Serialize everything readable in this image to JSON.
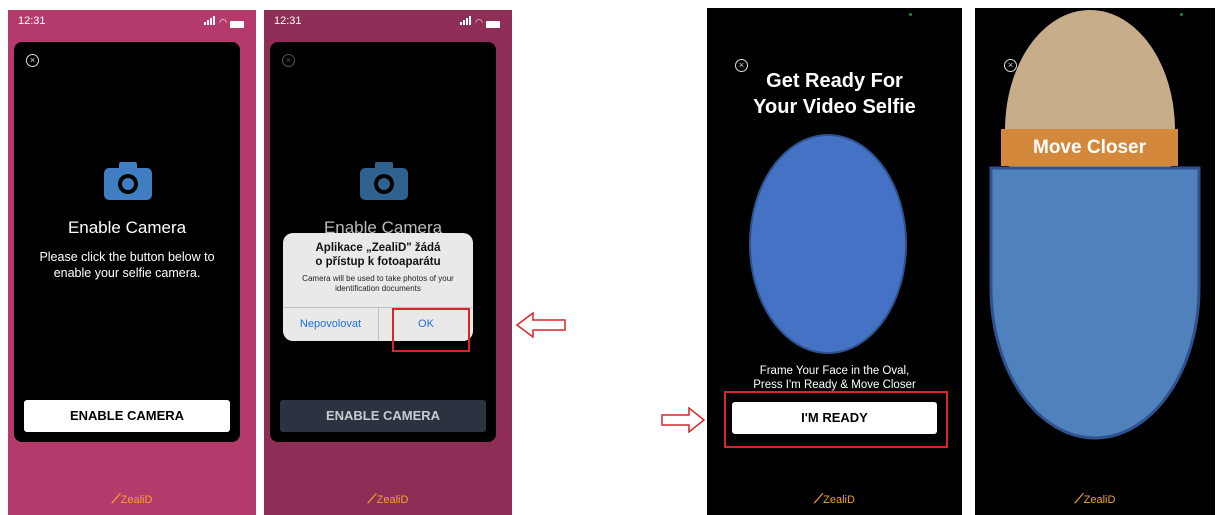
{
  "screen1": {
    "time": "12:31",
    "title": "Enable Camera",
    "description": "Please click the button below to enable your selfie camera.",
    "button": "ENABLE CAMERA",
    "logo": "ZealiD"
  },
  "screen2": {
    "time": "12:31",
    "title": "Enable Camera",
    "button": "ENABLE CAMERA",
    "logo": "ZealiD",
    "alert": {
      "title_line1": "Aplikace „ZealiD\" žádá",
      "title_line2": "o přístup k fotoaparátu",
      "message": "Camera will be used to take photos of your identification documents",
      "deny": "Nepovolovat",
      "allow": "OK"
    }
  },
  "screen3": {
    "title_line1": "Get Ready For",
    "title_line2": "Your Video Selfie",
    "instruction_line1": "Frame Your Face in the Oval,",
    "instruction_line2": "Press I'm Ready & Move Closer",
    "button": "I'M READY",
    "logo": "ZealiD"
  },
  "screen4": {
    "banner": "Move Closer",
    "logo": "ZealiD"
  },
  "colors": {
    "pink": "#b33a6b",
    "pink_dim": "#8e2d55",
    "oval_blue": "#4472c4",
    "banner_orange": "#d3883c",
    "highlight_red": "#d9252a",
    "logo_orange": "#f2a22c"
  }
}
